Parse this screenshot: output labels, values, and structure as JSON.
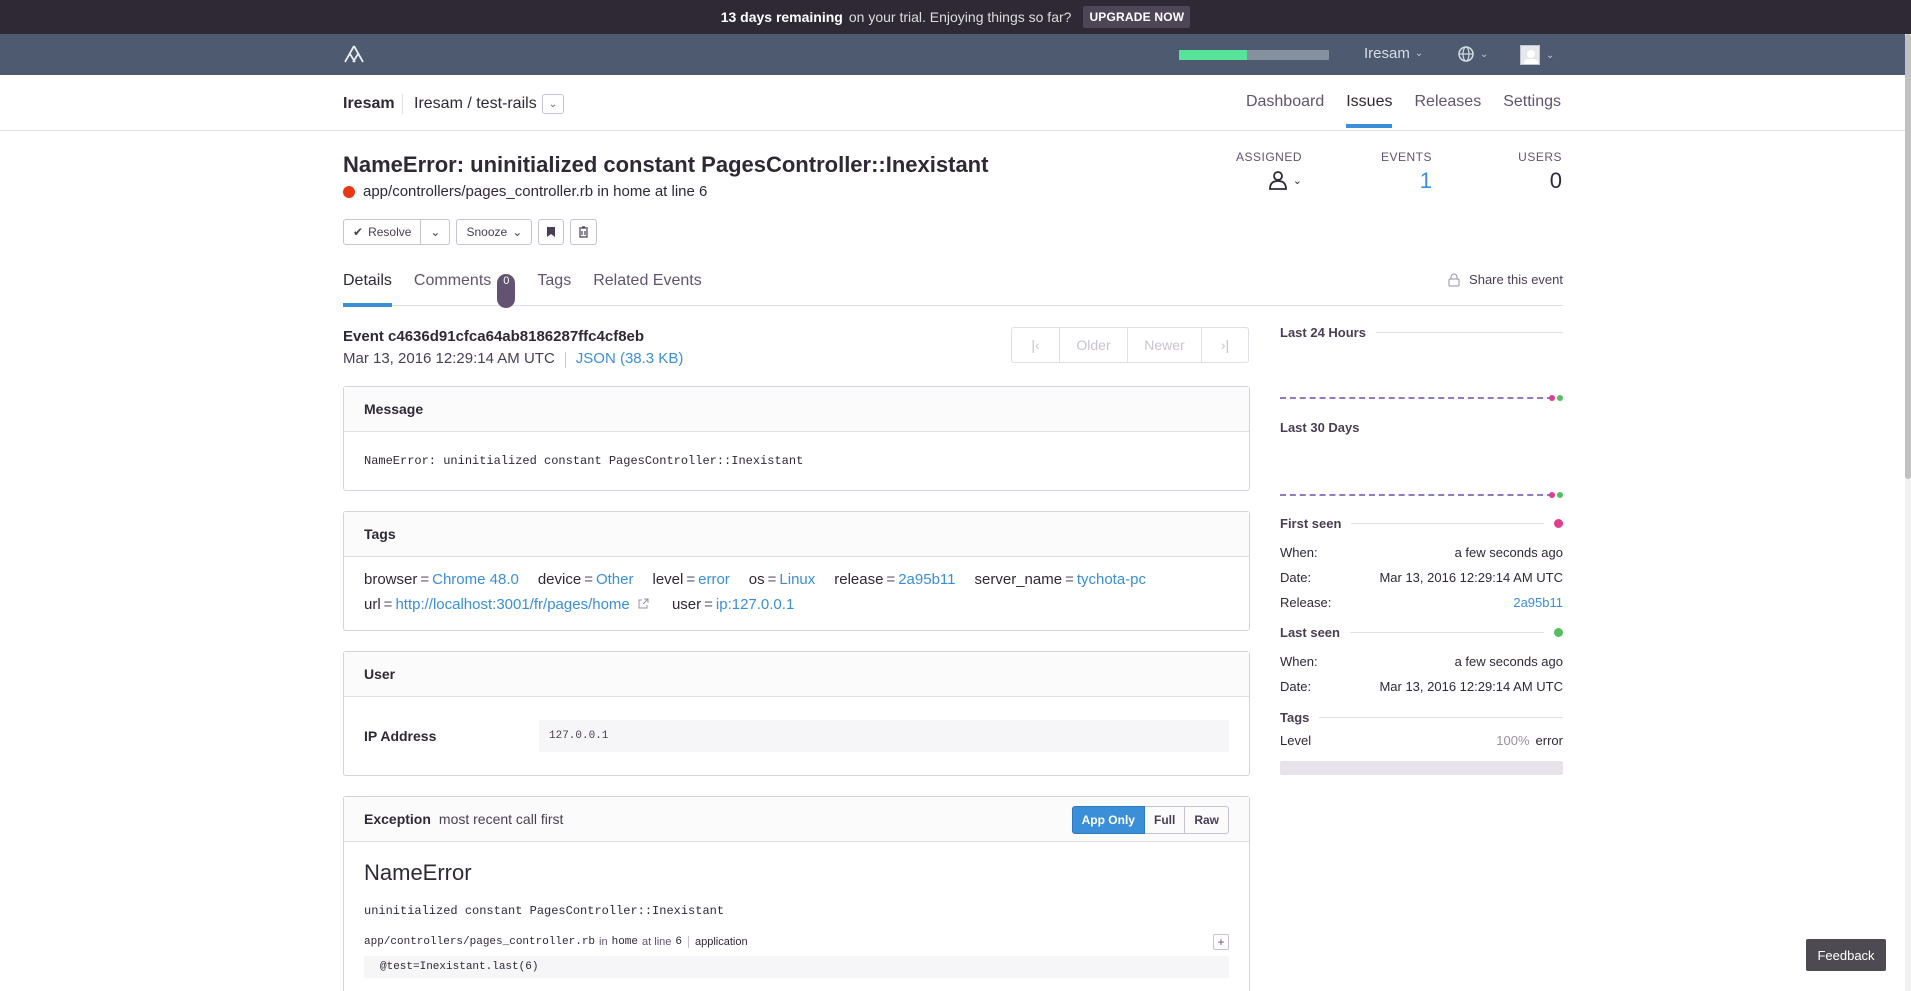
{
  "banner": {
    "days": "13 days remaining",
    "rest": "on your trial. Enjoying things so far?",
    "upgrade": "UPGRADE NOW"
  },
  "topnav": {
    "org": "Iresam",
    "quota_fraction": 0.45,
    "icons": [
      "sentry-logo-icon",
      "globe-icon",
      "avatar-icon"
    ]
  },
  "subhead": {
    "org": "Iresam",
    "project": "Iresam / test-rails",
    "nav": [
      "Dashboard",
      "Issues",
      "Releases",
      "Settings"
    ],
    "active_nav": "Issues"
  },
  "issue": {
    "title": "NameError: uninitialized constant PagesController::Inexistant",
    "culprit": "app/controllers/pages_controller.rb in home at line 6",
    "level_color": "#e63717",
    "stats": {
      "assigned_label": "ASSIGNED",
      "events_label": "EVENTS",
      "events": "1",
      "users_label": "USERS",
      "users": "0"
    },
    "actions": {
      "resolve": "Resolve",
      "snooze": "Snooze"
    }
  },
  "tabs": {
    "details": "Details",
    "comments": "Comments",
    "comments_count": "0",
    "tags": "Tags",
    "related": "Related Events",
    "share": "Share this event"
  },
  "event": {
    "id_line": "Event c4636d91cfca64ab8186287ffc4cf8eb",
    "date": "Mar 13, 2016 12:29:14 AM UTC",
    "json": "JSON (38.3 KB)",
    "pager": {
      "older": "Older",
      "newer": "Newer"
    }
  },
  "message": {
    "header": "Message",
    "text": "NameError: uninitialized constant PagesController::Inexistant"
  },
  "tags_box": {
    "header": "Tags",
    "items": [
      {
        "k": "browser",
        "v": "Chrome 48.0"
      },
      {
        "k": "device",
        "v": "Other"
      },
      {
        "k": "level",
        "v": "error"
      },
      {
        "k": "os",
        "v": "Linux"
      },
      {
        "k": "release",
        "v": "2a95b11"
      },
      {
        "k": "server_name",
        "v": "tychota-pc"
      },
      {
        "k": "url",
        "v": "http://localhost:3001/fr/pages/home"
      },
      {
        "k": "user",
        "v": "ip:127.0.0.1"
      }
    ]
  },
  "user_box": {
    "header": "User",
    "ip_label": "IP Address",
    "ip": "127.0.0.1"
  },
  "exception": {
    "header": "Exception",
    "sub": "most recent call first",
    "modes": [
      "App Only",
      "Full",
      "Raw"
    ],
    "type": "NameError",
    "value": "uninitialized constant PagesController::Inexistant",
    "frame_file": "app/controllers/pages_controller.rb",
    "frame_in": "in",
    "frame_fn": "home",
    "frame_at": "at line",
    "frame_line": "6",
    "frame_tag": "application",
    "code": "@test=Inexistant.last(6)"
  },
  "sidebar": {
    "last24": "Last 24 Hours",
    "last30": "Last 30 Days",
    "first_seen": {
      "title": "First seen",
      "when_l": "When:",
      "when": "a few seconds ago",
      "date_l": "Date:",
      "date": "Mar 13, 2016 12:29:14 AM UTC",
      "release_l": "Release:",
      "release": "2a95b11"
    },
    "last_seen": {
      "title": "Last seen",
      "when_l": "When:",
      "when": "a few seconds ago",
      "date_l": "Date:",
      "date": "Mar 13, 2016 12:29:14 AM UTC"
    },
    "tags_title": "Tags",
    "level_l": "Level",
    "level_pct": "100%",
    "level_v": "error"
  },
  "feedback": "Feedback",
  "colors": {
    "accent": "#3b8fd8",
    "nav_bg": "#4d5a6f",
    "banner_bg": "#2f2936"
  }
}
